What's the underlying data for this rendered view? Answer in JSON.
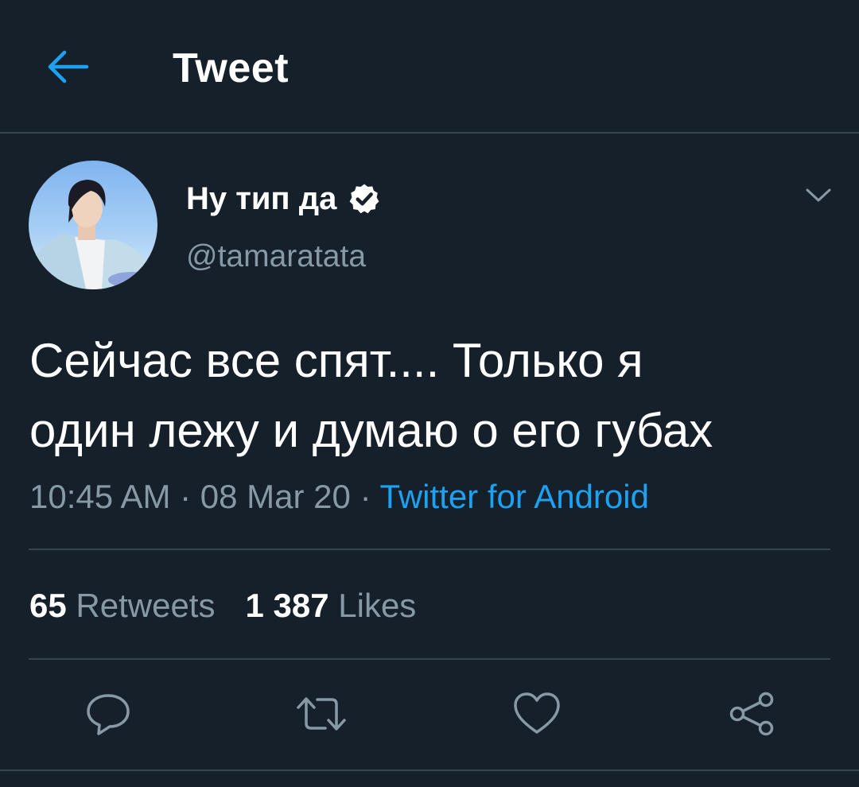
{
  "header": {
    "title": "Tweet",
    "back_icon": "arrow-left-icon"
  },
  "tweet": {
    "author": {
      "display_name": "Ну тип да",
      "handle": "@tamaratata",
      "verified": true
    },
    "text_line1": "Сейчас все спят.... Только я",
    "text_line2": "один лежу и думаю о его губах",
    "time": "10:45 AM",
    "sep1": " · ",
    "date": "08 Mar 20",
    "sep2": " · ",
    "source": "Twitter for Android",
    "stats": {
      "retweets_count": "65",
      "retweets_label": "Retweets",
      "likes_count": "1 387",
      "likes_label": "Likes"
    },
    "actions": [
      "reply-icon",
      "retweet-icon",
      "like-icon",
      "share-icon"
    ]
  },
  "colors": {
    "background": "#15202b",
    "accent": "#1da1f2",
    "secondary_text": "#8899a6",
    "divider": "#38444d"
  }
}
